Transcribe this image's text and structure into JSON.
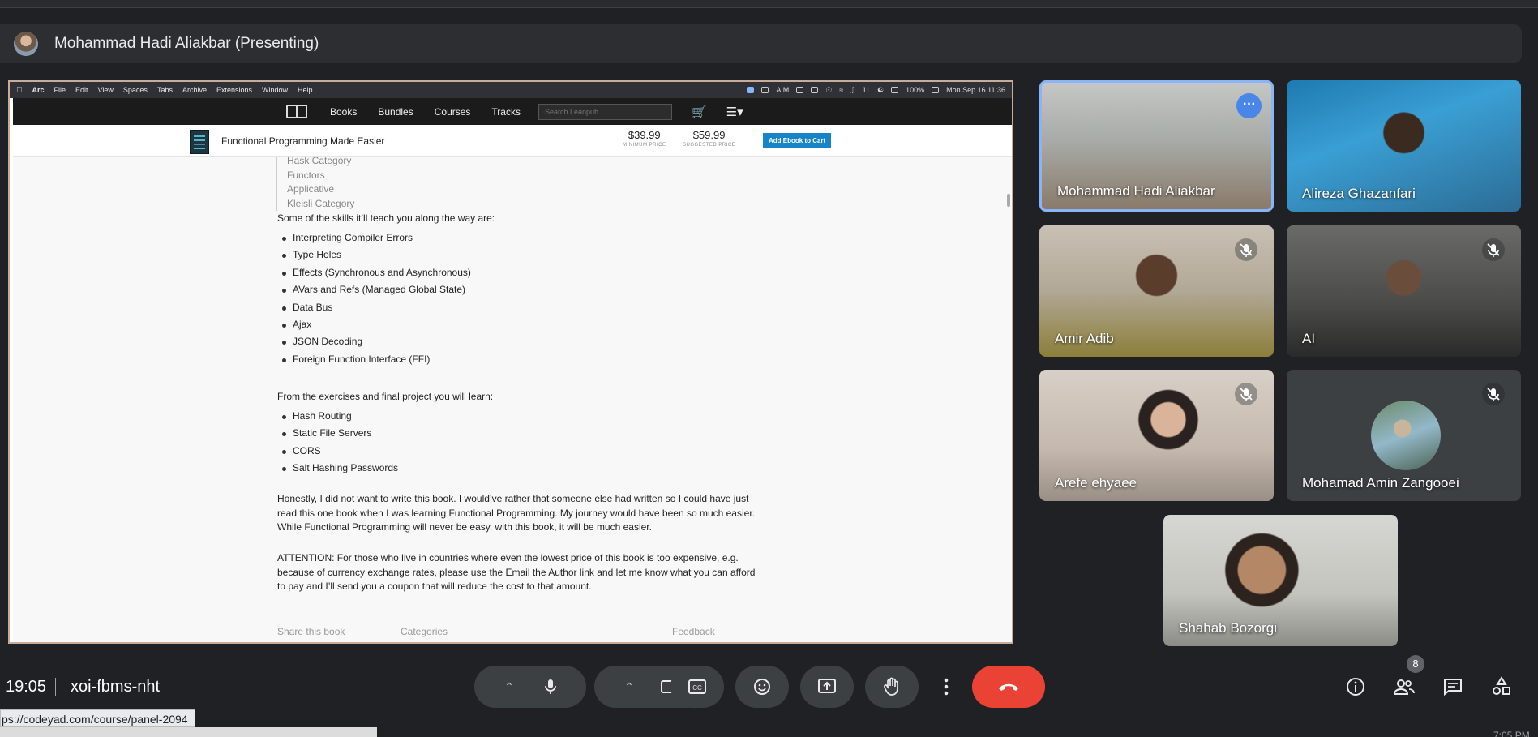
{
  "presenter": {
    "title": "Mohammad Hadi Aliakbar (Presenting)"
  },
  "mac_menubar": {
    "items": [
      "Arc",
      "File",
      "Edit",
      "View",
      "Spaces",
      "Tabs",
      "Archive",
      "Extensions",
      "Window",
      "Help"
    ],
    "status": [
      "A|M",
      "11",
      "100%",
      "Mon Sep 16 11:36"
    ]
  },
  "leanpub": {
    "nav": [
      "Books",
      "Bundles",
      "Courses",
      "Tracks"
    ],
    "search_placeholder": "Search Leanpub",
    "book_title": "Functional Programming Made Easier",
    "min_price": "$39.99",
    "min_caption": "MINIMUM PRICE",
    "suggested_price": "$59.99",
    "suggested_caption": "SUGGESTED PRICE",
    "add_cart": "Add Ebook to Cart"
  },
  "content": {
    "toc": [
      "Hask Category",
      "Functors",
      "Applicative",
      "Kleisli Category"
    ],
    "skills_intro": "Some of the skills it’ll teach you along the way are:",
    "skills": [
      "Interpreting Compiler Errors",
      "Type Holes",
      "Effects (Synchronous and Asynchronous)",
      "AVars and Refs (Managed Global State)",
      "Data Bus",
      "Ajax",
      "JSON Decoding",
      "Foreign Function Interface (FFI)"
    ],
    "exercises_intro": "From the exercises and final project you will learn:",
    "exercises": [
      "Hash Routing",
      "Static File Servers",
      "CORS",
      "Salt Hashing Passwords"
    ],
    "honestly": "Honestly, I did not want to write this book. I would’ve rather that someone else had written so I could have just read this one book when I was learning Functional Programming. My journey would have been so much easier. While Functional Programming will never be easy, with this book, it will be much easier.",
    "attention": "ATTENTION: For those who live in countries where even the lowest price of this book is too expensive, e.g. because of currency exchange rates, please use the Email the Author link and let me know what you can afford to pay and I’ll send you a coupon that will reduce the cost to that amount.",
    "footer": [
      "Share this book",
      "Categories",
      "Feedback"
    ]
  },
  "participants": [
    {
      "name": "Mohammad Hadi Aliakbar",
      "muted": false,
      "presenting": true
    },
    {
      "name": "Alireza Ghazanfari",
      "muted": false
    },
    {
      "name": "Amir Adib",
      "muted": true
    },
    {
      "name": "AI",
      "muted": true
    },
    {
      "name": "Arefe ehyaee",
      "muted": true
    },
    {
      "name": "Mohamad Amin Zangooei",
      "muted": true
    },
    {
      "name": "Shahab Bozorgi",
      "muted": false
    }
  ],
  "toolbar": {
    "time": "19:05",
    "meeting_code": "xoi-fbms-nht",
    "people_count": "8"
  },
  "status_url": "ps://codeyad.com/course/panel-2094",
  "corner_time": "7:05 PM",
  "colors": {
    "end_call": "#ea4335",
    "active_border": "#8ab4f8",
    "meet_bg": "#202124",
    "cart_button": "#1784c7"
  }
}
